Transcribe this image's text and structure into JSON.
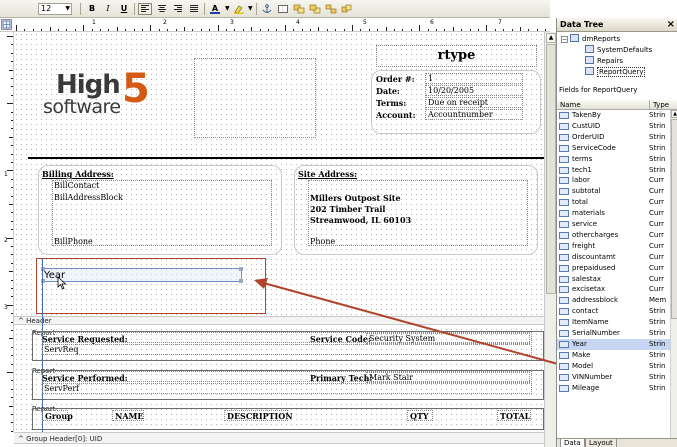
{
  "toolbar": {
    "font_size": "12",
    "bold": "B",
    "italic": "I",
    "underline": "U",
    "font_color_glyph": "A"
  },
  "rulers": {
    "h_numbers": [
      "1",
      "2",
      "3",
      "4",
      "5",
      "6",
      "7"
    ],
    "v_numbers": [
      "1",
      "2",
      "3",
      "4"
    ]
  },
  "report": {
    "logo": {
      "high": "High",
      "five": "5",
      "software": "software"
    },
    "title_field": "rtype",
    "order": [
      {
        "label": "Order #:",
        "value": "1"
      },
      {
        "label": "Date:",
        "value": "10/20/2005"
      },
      {
        "label": "Terms:",
        "value": "Due on receipt"
      },
      {
        "label": "Account:",
        "value": "Accountnumber"
      }
    ],
    "billing": {
      "title": "Billing Address:",
      "contact": "BillContact",
      "block": "BillAddressBlock",
      "phone": "BillPhone"
    },
    "site": {
      "title": "Site Address:",
      "line1": "Millers Outpost Site",
      "line2": "202 Timber Trail",
      "line3": "Streamwood, IL 60103",
      "phone": "Phone"
    },
    "selected_field": "Year",
    "header_band": "Header",
    "sub1": {
      "tag": "Report",
      "label": "Service Requested:",
      "field": "ServReq",
      "code_label": "Service Code:",
      "code_value": "Security System"
    },
    "sub2": {
      "tag": "Report",
      "label": "Service Performed:",
      "field": "ServPerf",
      "tech_label": "Primary Tech:",
      "tech_value": "Mark Stair"
    },
    "sub3": {
      "tag": "Report",
      "cols": [
        "Group",
        "NAME",
        "DESCRIPTION",
        "QTY",
        "TOTAL"
      ]
    },
    "group_header_band": "Group Header[0]: UID"
  },
  "panel": {
    "title": "Data Tree",
    "close": "×",
    "tree_root": "dmReports",
    "tree_children": [
      "SystemDefaults",
      "Repairs",
      "ReportQuery"
    ],
    "fields_label": "Fields for ReportQuery",
    "col_name": "Name",
    "col_type": "Type",
    "fields": [
      {
        "name": "TakenBy",
        "type": "Strin"
      },
      {
        "name": "CustUID",
        "type": "Strin"
      },
      {
        "name": "OrderUID",
        "type": "Strin"
      },
      {
        "name": "ServiceCode",
        "type": "Strin"
      },
      {
        "name": "terms",
        "type": "Strin"
      },
      {
        "name": "tech1",
        "type": "Strin"
      },
      {
        "name": "labor",
        "type": "Curr"
      },
      {
        "name": "subtotal",
        "type": "Curr"
      },
      {
        "name": "total",
        "type": "Curr"
      },
      {
        "name": "materials",
        "type": "Curr"
      },
      {
        "name": "service",
        "type": "Curr"
      },
      {
        "name": "othercharges",
        "type": "Curr"
      },
      {
        "name": "freight",
        "type": "Curr"
      },
      {
        "name": "discountamt",
        "type": "Curr"
      },
      {
        "name": "prepaidused",
        "type": "Curr"
      },
      {
        "name": "salestax",
        "type": "Curr"
      },
      {
        "name": "excisetax",
        "type": "Curr"
      },
      {
        "name": "addressblock",
        "type": "Mem"
      },
      {
        "name": "contact",
        "type": "Strin"
      },
      {
        "name": "ItemName",
        "type": "Strin"
      },
      {
        "name": "SerialNumber",
        "type": "Strin"
      },
      {
        "name": "Year",
        "type": "Strin"
      },
      {
        "name": "Make",
        "type": "Strin"
      },
      {
        "name": "Model",
        "type": "Strin"
      },
      {
        "name": "VINNumber",
        "type": "Strin"
      },
      {
        "name": "Mileage",
        "type": "Strin"
      }
    ],
    "selected_index": 21,
    "tabs": [
      "Data",
      "Layout"
    ]
  },
  "colors": {
    "logo_grey": "#3a3a3a",
    "logo_orange": "#d35a12",
    "arrow": "#b0432a",
    "selection": "#c5d5f2"
  }
}
